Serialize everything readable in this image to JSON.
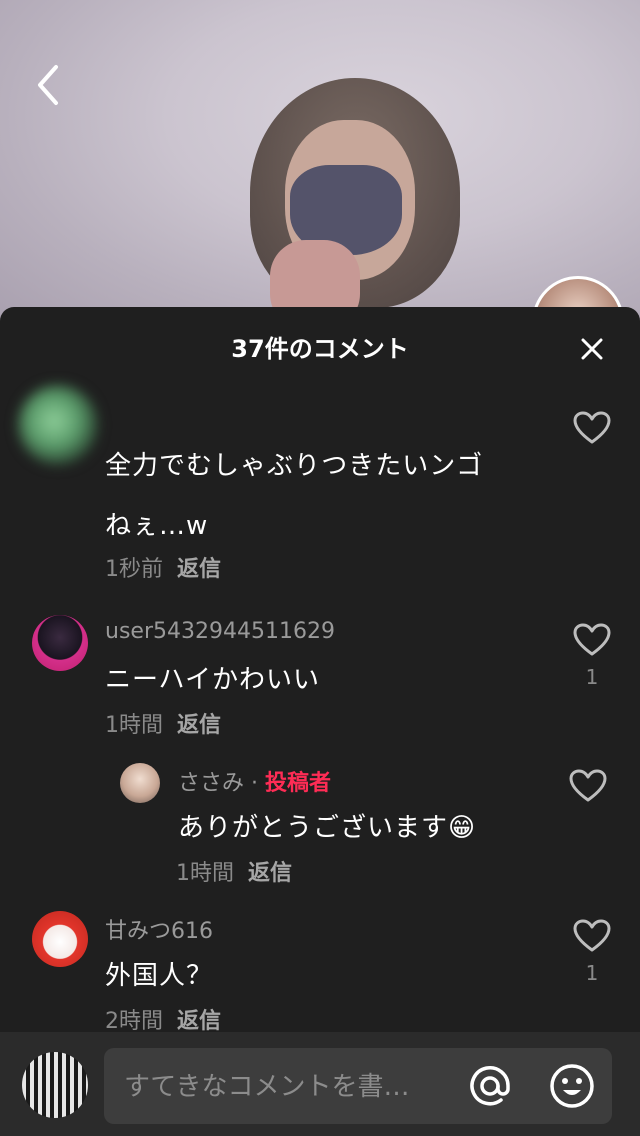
{
  "sheet": {
    "title": "37件のコメント"
  },
  "comments": [
    {
      "name": "",
      "text_line1": "全力でむしゃぶりつきたいンゴ",
      "text_line2": "ねぇ…w",
      "time": "1秒前",
      "reply_label": "返信",
      "likes": ""
    },
    {
      "name": "user5432944511629",
      "text": "ニーハイかわいい",
      "time": "1時間",
      "reply_label": "返信",
      "likes": "1"
    },
    {
      "name": "ささみ",
      "separator": " · ",
      "author_tag": "投稿者",
      "text": "ありがとうございます😁",
      "time": "1時間",
      "reply_label": "返信",
      "likes": ""
    },
    {
      "name": "甘みつ616",
      "text": "外国人？",
      "time": "2時間",
      "reply_label": "返信",
      "likes": "1"
    }
  ],
  "composer": {
    "placeholder": "すてきなコメントを書…"
  },
  "icons": {
    "back": "chevron-left-icon",
    "close": "close-icon",
    "like": "heart-outline-icon",
    "mention": "at-icon",
    "emoji": "smiley-icon"
  },
  "colors": {
    "sheet_bg": "#1f1f1f",
    "author_tag": "#fe2c55",
    "composer_bg": "#2b2b2b"
  }
}
